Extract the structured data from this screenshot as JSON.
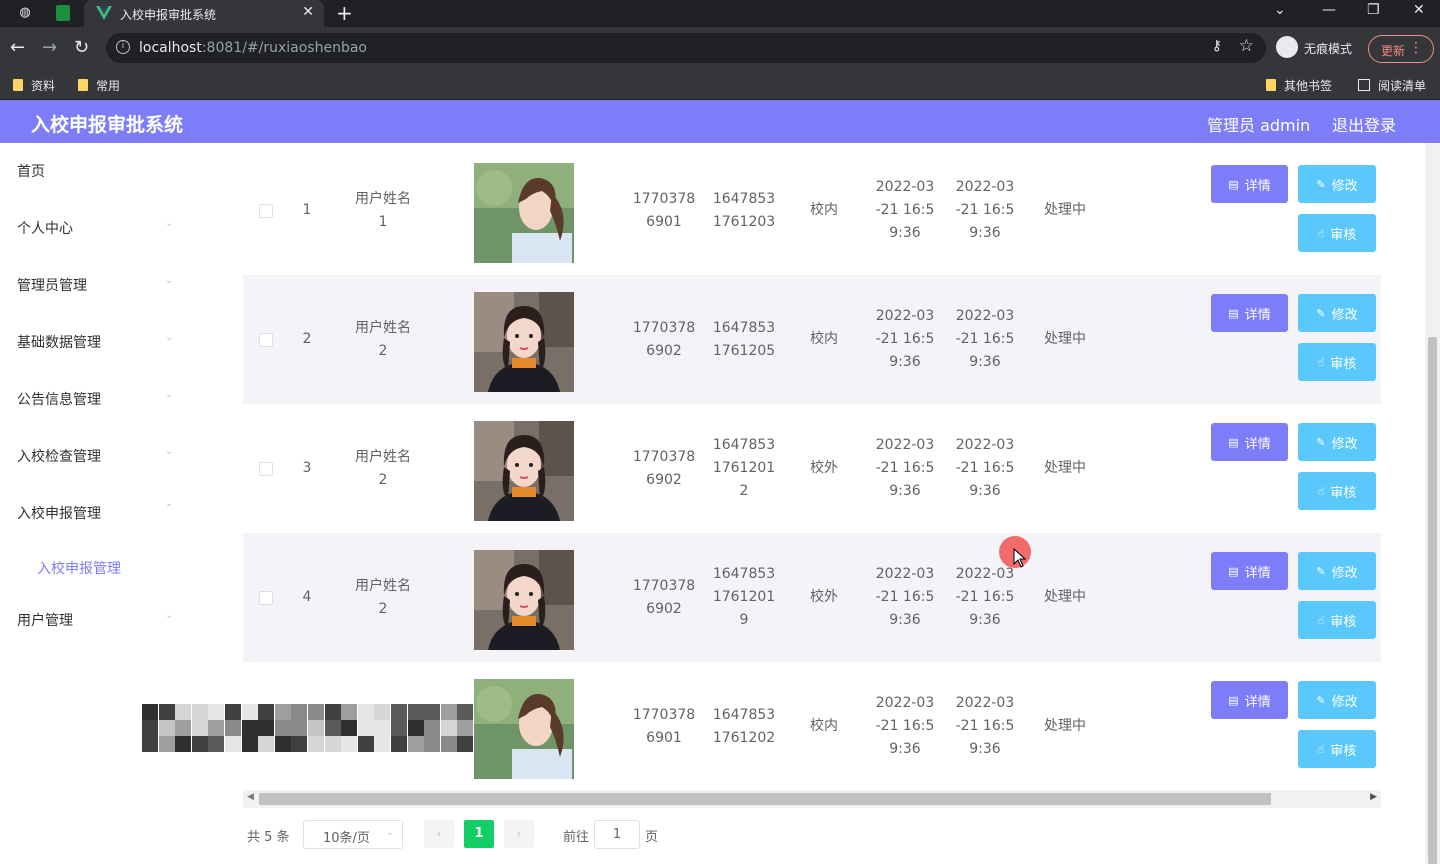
{
  "browser": {
    "tab_title": "入校申报审批系统",
    "url_host": "localhost",
    "url_rest": ":8081/#/ruxiaoshenbao",
    "incognito_label": "无痕模式",
    "update_label": "更新",
    "bookmarks": [
      "资料",
      "常用"
    ],
    "bookmarks_right": [
      "其他书签",
      "阅读清单"
    ]
  },
  "header": {
    "title": "入校申报审批系统",
    "user": "管理员 admin",
    "logout": "退出登录"
  },
  "sidebar": {
    "items": [
      "首页",
      "个人中心",
      "管理员管理",
      "基础数据管理",
      "公告信息管理",
      "入校检查管理",
      "入校申报管理",
      "用户管理"
    ],
    "active_sub": "入校申报管理"
  },
  "table": {
    "buttons": {
      "detail": "详情",
      "edit": "修改",
      "review": "审核"
    },
    "rows": [
      {
        "index": "1",
        "name": [
          "用户姓名",
          "1"
        ],
        "phone": [
          "1770378",
          "6901"
        ],
        "code": [
          "1647853",
          "1761203"
        ],
        "location": "校内",
        "time1": [
          "2022-03",
          "-21 16:5",
          "9:36"
        ],
        "time2": [
          "2022-03",
          "-21 16:5",
          "9:36"
        ],
        "status": "处理中",
        "photo": "ponytail-girl-photo"
      },
      {
        "index": "2",
        "name": [
          "用户姓名",
          "2"
        ],
        "phone": [
          "1770378",
          "6902"
        ],
        "code": [
          "1647853",
          "1761205"
        ],
        "location": "校内",
        "time1": [
          "2022-03",
          "-21 16:5",
          "9:36"
        ],
        "time2": [
          "2022-03",
          "-21 16:5",
          "9:36"
        ],
        "status": "处理中",
        "photo": "girl-portrait-photo"
      },
      {
        "index": "3",
        "name": [
          "用户姓名",
          "2"
        ],
        "phone": [
          "1770378",
          "6902"
        ],
        "code": [
          "1647853",
          "1761201",
          "2"
        ],
        "location": "校外",
        "time1": [
          "2022-03",
          "-21 16:5",
          "9:36"
        ],
        "time2": [
          "2022-03",
          "-21 16:5",
          "9:36"
        ],
        "status": "处理中",
        "photo": "girl-portrait-photo"
      },
      {
        "index": "4",
        "name": [
          "用户姓名",
          "2"
        ],
        "phone": [
          "1770378",
          "6902"
        ],
        "code": [
          "1647853",
          "1761201",
          "9"
        ],
        "location": "校外",
        "time1": [
          "2022-03",
          "-21 16:5",
          "9:36"
        ],
        "time2": [
          "2022-03",
          "-21 16:5",
          "9:36"
        ],
        "status": "处理中",
        "photo": "girl-portrait-photo"
      },
      {
        "index": "",
        "name": [
          "",
          ""
        ],
        "phone": [
          "1770378",
          "6901"
        ],
        "code": [
          "1647853",
          "1761202"
        ],
        "location": "校内",
        "time1": [
          "2022-03",
          "-21 16:5",
          "9:36"
        ],
        "time2": [
          "2022-03",
          "-21 16:5",
          "9:36"
        ],
        "status": "处理中",
        "photo": "ponytail-girl-photo"
      }
    ]
  },
  "pagination": {
    "total": "共 5 条",
    "page_size": "10条/页",
    "current": "1",
    "goto_label": "前往",
    "goto_value": "1",
    "unit": "页"
  },
  "colors": {
    "header": "#7d7cf9",
    "detail_button": "#7d7cf9",
    "edit_button": "#5ac8fa",
    "active_page": "#13ce66"
  }
}
